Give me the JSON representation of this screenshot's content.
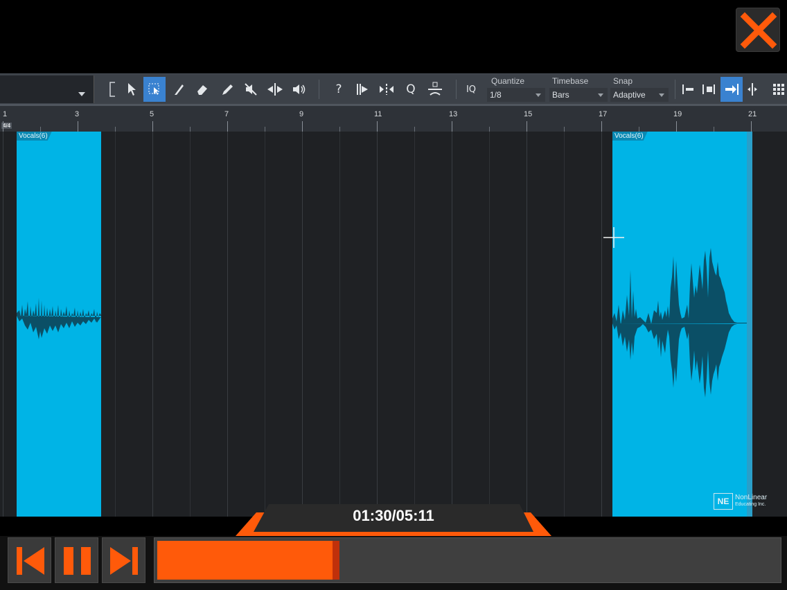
{
  "toolbar": {
    "quantize": {
      "label": "Quantize",
      "value": "1/8"
    },
    "timebase": {
      "label": "Timebase",
      "value": "Bars"
    },
    "snap": {
      "label": "Snap",
      "value": "Adaptive"
    },
    "help_label": "?",
    "iq_label": "IQ",
    "q_label": "Q"
  },
  "ruler": {
    "time_signature": "4/4",
    "ticks": [
      {
        "label": "1"
      },
      {
        "label": "3"
      },
      {
        "label": "5"
      },
      {
        "label": "7"
      },
      {
        "label": "9"
      },
      {
        "label": "11"
      },
      {
        "label": "13"
      },
      {
        "label": "15"
      },
      {
        "label": "17"
      },
      {
        "label": "19"
      },
      {
        "label": "21"
      }
    ]
  },
  "clips": [
    {
      "name": "Vocals(6)"
    },
    {
      "name": "Vocals(6)"
    }
  ],
  "watermark": {
    "logo": "NE",
    "line1": "NonLinear",
    "line2": "Educating Inc."
  },
  "player": {
    "time": "01:30/05:11",
    "progress": 0.294
  },
  "colors": {
    "clip": "#00b4e6",
    "accent": "#ff5a0a",
    "toolbar_active": "#3a82d0"
  }
}
